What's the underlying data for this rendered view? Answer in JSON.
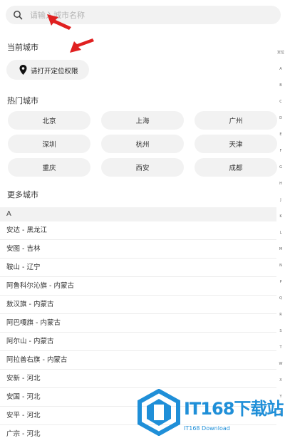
{
  "search": {
    "placeholder": "请输入城市名称"
  },
  "current_city": {
    "title": "当前城市",
    "location_button": "请打开定位权限"
  },
  "hot_cities": {
    "title": "热门城市",
    "items": [
      "北京",
      "上海",
      "广州",
      "深圳",
      "杭州",
      "天津",
      "重庆",
      "西安",
      "成都"
    ]
  },
  "more_cities": {
    "title": "更多城市",
    "letter": "A",
    "items": [
      "安达 - 黑龙江",
      "安图 - 吉林",
      "鞍山 - 辽宁",
      "阿鲁科尔沁旗 - 内蒙古",
      "敖汉旗 - 内蒙古",
      "阿巴嘎旗 - 内蒙古",
      "阿尔山 - 内蒙古",
      "阿拉善右旗 - 内蒙古",
      "安新 - 河北",
      "安国 - 河北",
      "安平 - 河北",
      "广宗 - 河北"
    ]
  },
  "index_bar": {
    "items": [
      "定位",
      "A",
      "B",
      "C",
      "D",
      "E",
      "F",
      "G",
      "H",
      "J",
      "K",
      "L",
      "M",
      "N",
      "P",
      "Q",
      "R",
      "S",
      "T",
      "W",
      "X",
      "Y",
      "Z"
    ]
  },
  "watermark": {
    "brand": "IT168下载站",
    "sub": "IT168 Download"
  },
  "colors": {
    "accent_arrow": "#e02020",
    "chip_bg": "#f2f2f2",
    "watermark_blue": "#1f8fd8"
  }
}
